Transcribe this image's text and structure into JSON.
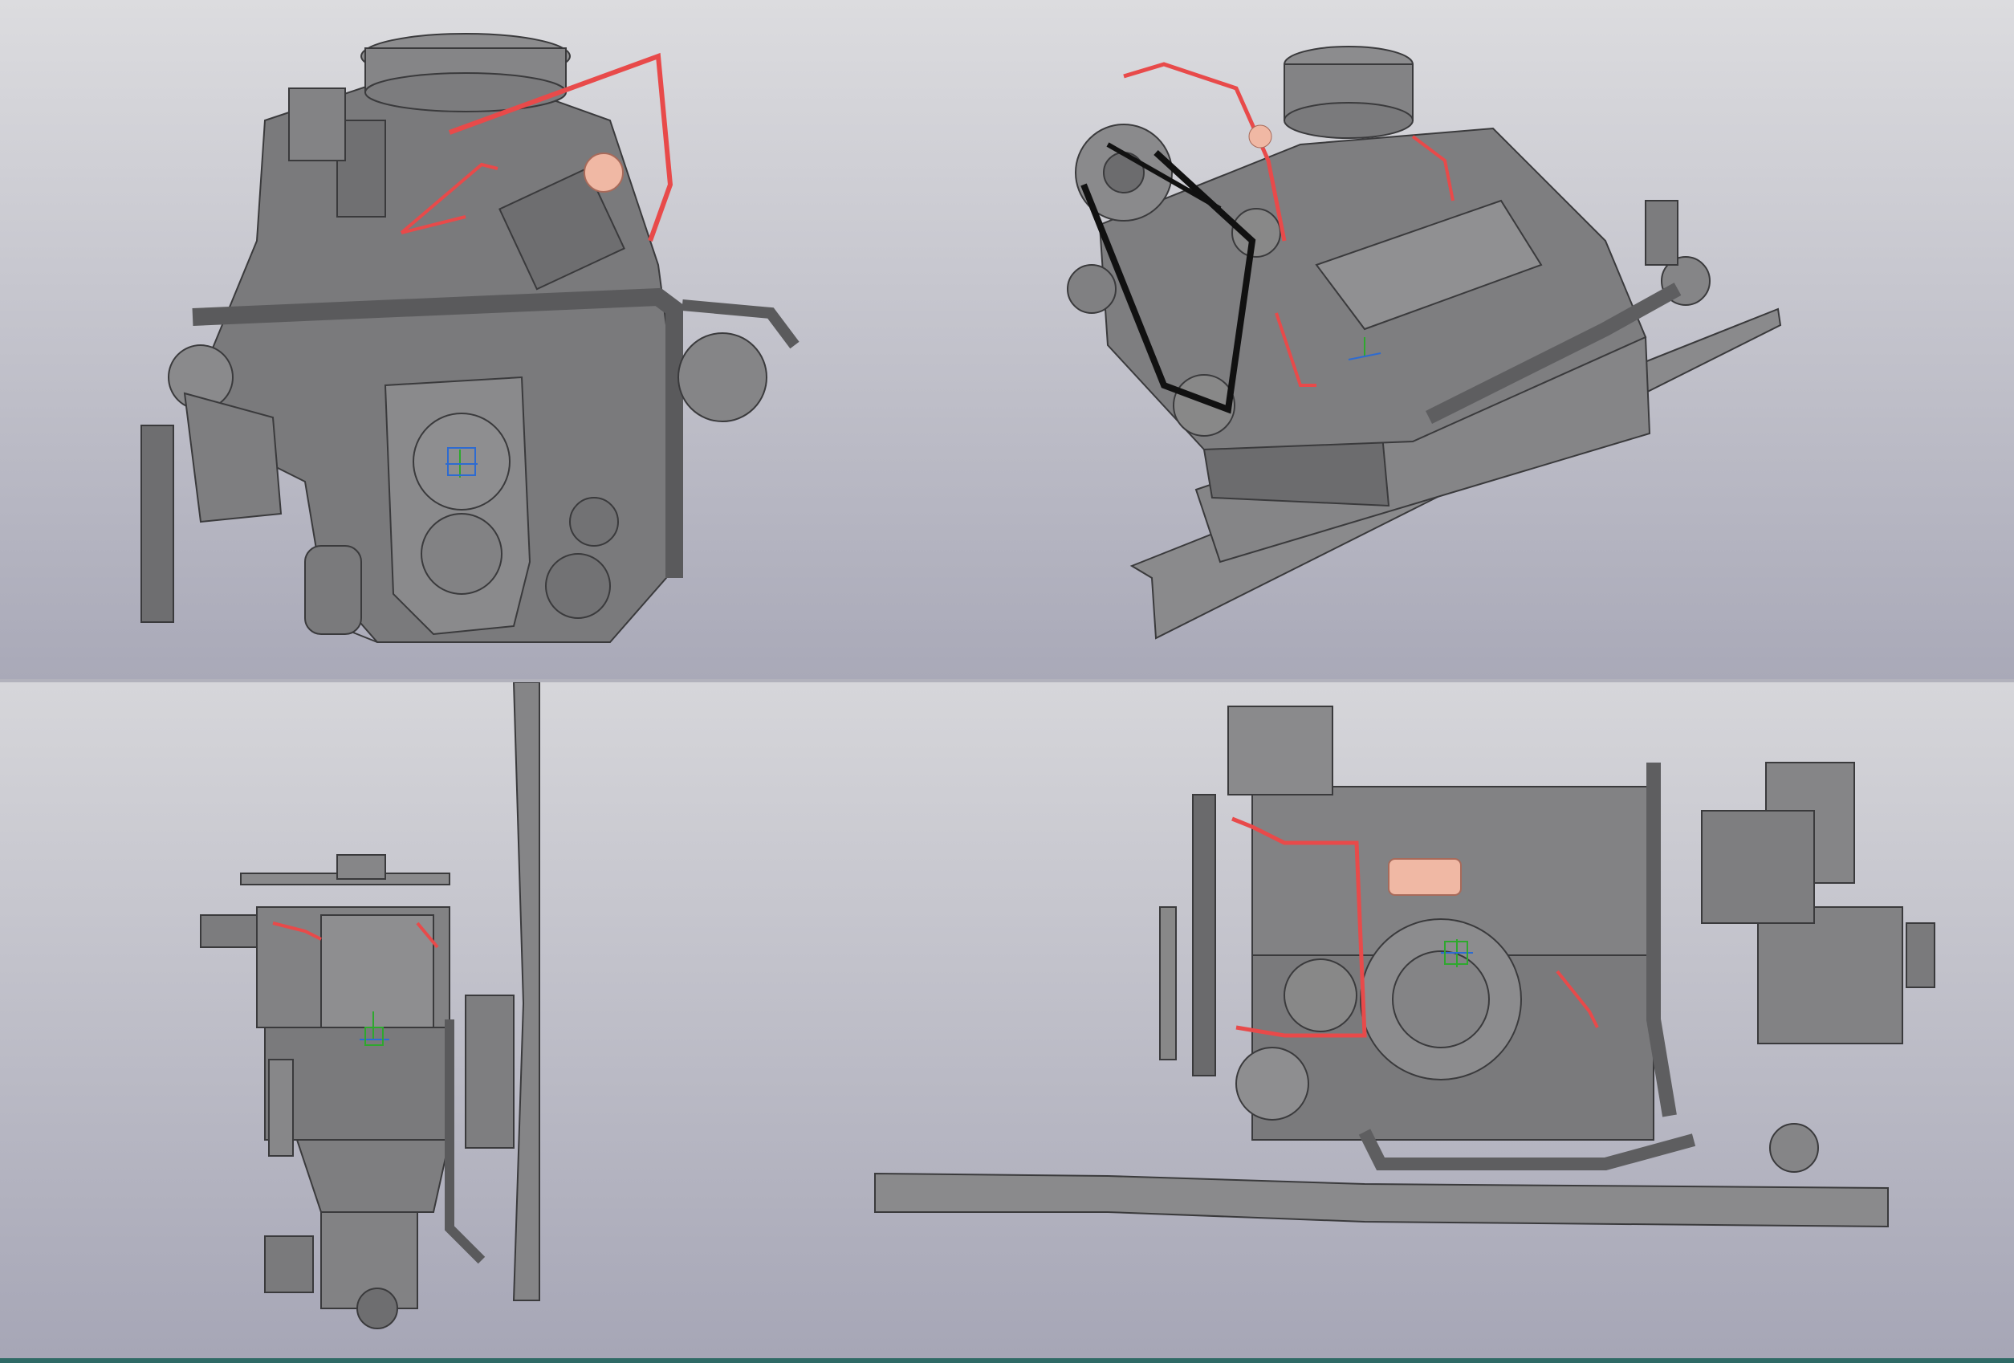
{
  "app": {
    "accent_color": "#e84a4a",
    "part_color": "#7a7a7c",
    "highlight_color": "#f0b8a4",
    "status_bar_color": "#2f6a66"
  },
  "views": [
    {
      "id": "front",
      "icon": "engine-front-view"
    },
    {
      "id": "isometric",
      "icon": "engine-isometric-view"
    },
    {
      "id": "side",
      "icon": "engine-side-view"
    },
    {
      "id": "top",
      "icon": "engine-top-view"
    }
  ]
}
